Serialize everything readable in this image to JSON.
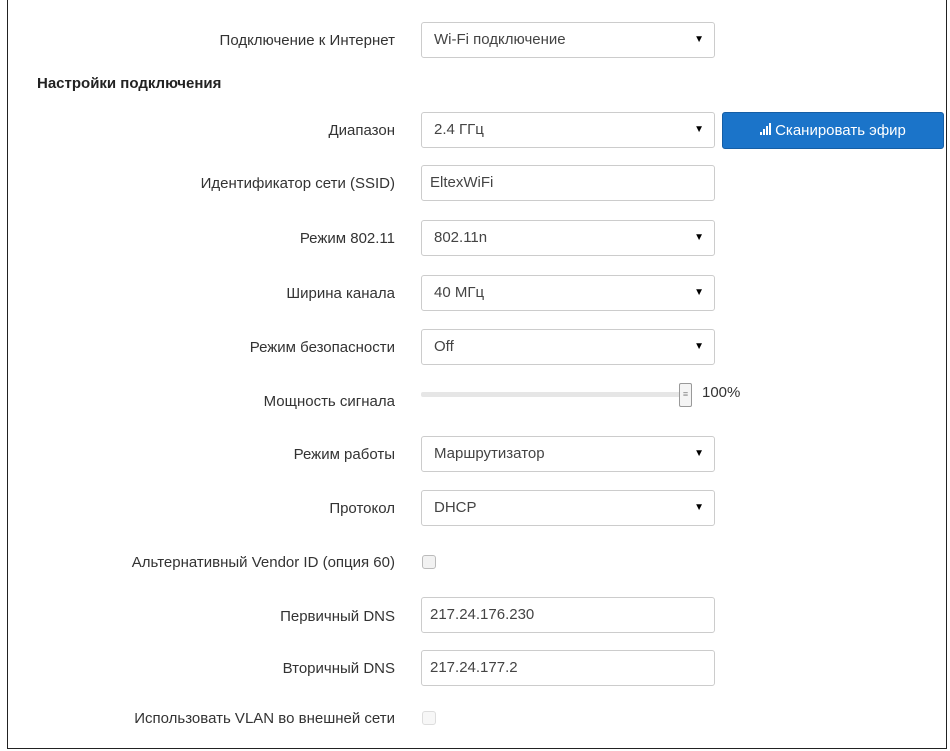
{
  "internet_connection": {
    "label": "Подключение к Интернет",
    "value": "Wi-Fi подключение"
  },
  "section_title": "Настройки подключения",
  "band": {
    "label": "Диапазон",
    "value": "2.4 ГГц"
  },
  "scan_button": {
    "label": "Сканировать эфир",
    "icon": "signal-bars-icon"
  },
  "ssid": {
    "label": "Идентификатор сети (SSID)",
    "value": "EltexWiFi"
  },
  "mode_80211": {
    "label": "Режим 802.11",
    "value": "802.11n"
  },
  "channel_width": {
    "label": "Ширина канала",
    "value": "40 МГц"
  },
  "security_mode": {
    "label": "Режим безопасности",
    "value": "Off"
  },
  "signal_power": {
    "label": "Мощность сигнала",
    "value_text": "100%",
    "fraction": 1.0
  },
  "operation_mode": {
    "label": "Режим работы",
    "value": "Маршрутизатор"
  },
  "protocol": {
    "label": "Протокол",
    "value": "DHCP"
  },
  "vendor_id": {
    "label": "Альтернативный Vendor ID (опция 60)",
    "checked": false
  },
  "primary_dns": {
    "label": "Первичный DNS",
    "value": "217.24.176.230"
  },
  "secondary_dns": {
    "label": "Вторичный DNS",
    "value": "217.24.177.2"
  },
  "use_vlan": {
    "label": "Использовать VLAN во внешней сети",
    "checked": false,
    "disabled": true
  }
}
